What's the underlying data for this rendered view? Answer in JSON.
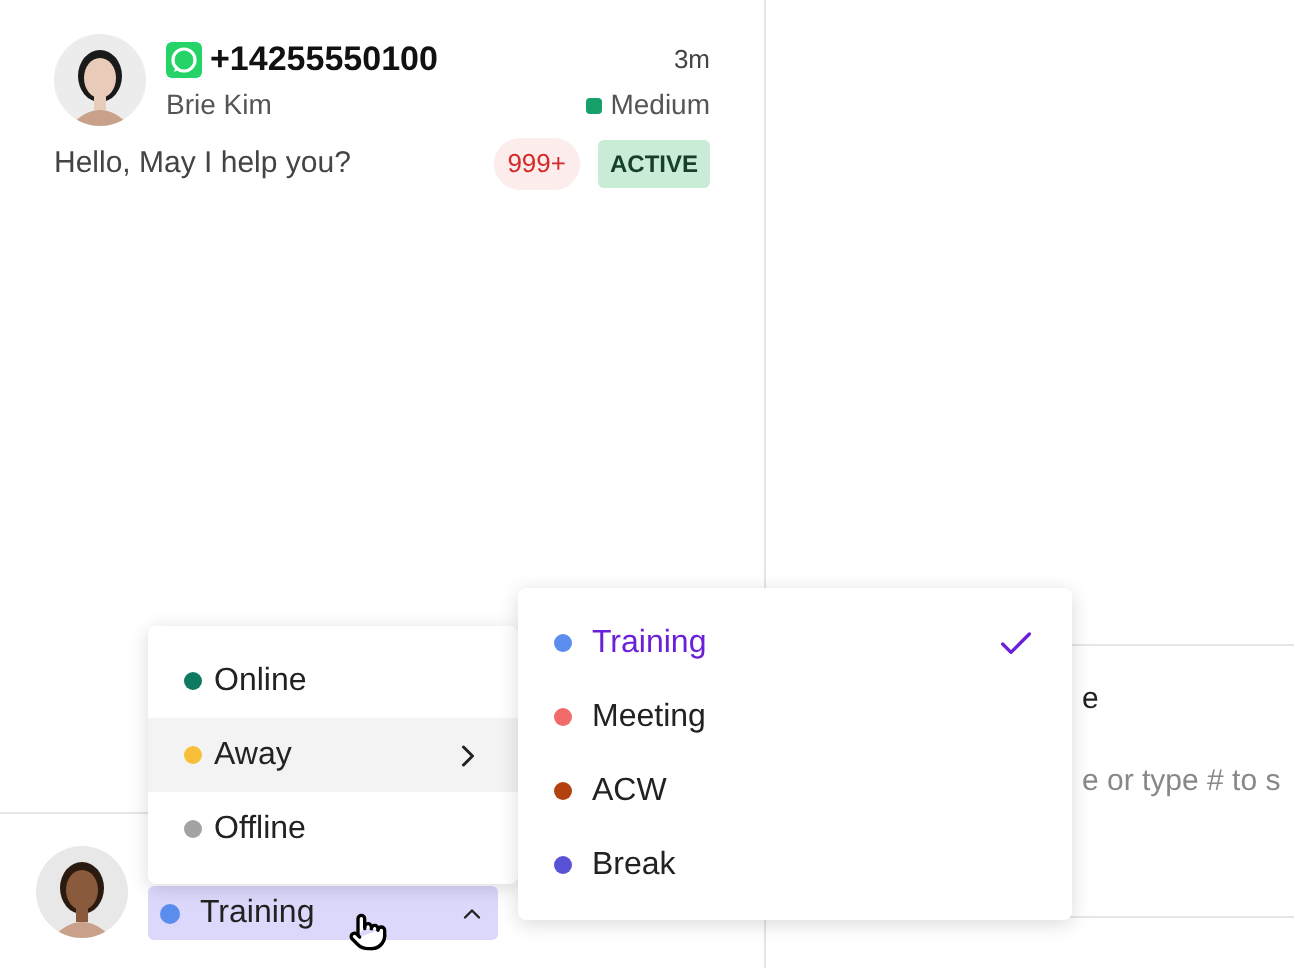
{
  "conversation": {
    "phone": "+14255550100",
    "name": "Brie Kim",
    "time": "3m",
    "priority": {
      "label": "Medium",
      "color": "#16a06a"
    },
    "message": "Hello, May I help you?",
    "unread": "999+",
    "status": "ACTIVE"
  },
  "compose": {
    "heading": "e",
    "placeholder": "e or type # to s"
  },
  "status_menu": [
    {
      "label": "Online",
      "color": "#0f7a62",
      "selected": false,
      "submenu": false
    },
    {
      "label": "Away",
      "color": "#f8c03a",
      "selected": true,
      "submenu": true
    },
    {
      "label": "Offline",
      "color": "#a3a3a3",
      "selected": false,
      "submenu": false
    }
  ],
  "away_menu": [
    {
      "label": "Training",
      "color": "#5b8def",
      "selected": true
    },
    {
      "label": "Meeting",
      "color": "#f26b6b",
      "selected": false
    },
    {
      "label": "ACW",
      "color": "#b3420f",
      "selected": false
    },
    {
      "label": "Break",
      "color": "#5a52d6",
      "selected": false
    }
  ],
  "agent": {
    "status": {
      "label": "Training",
      "color": "#5b8def"
    },
    "menu_open": true
  }
}
